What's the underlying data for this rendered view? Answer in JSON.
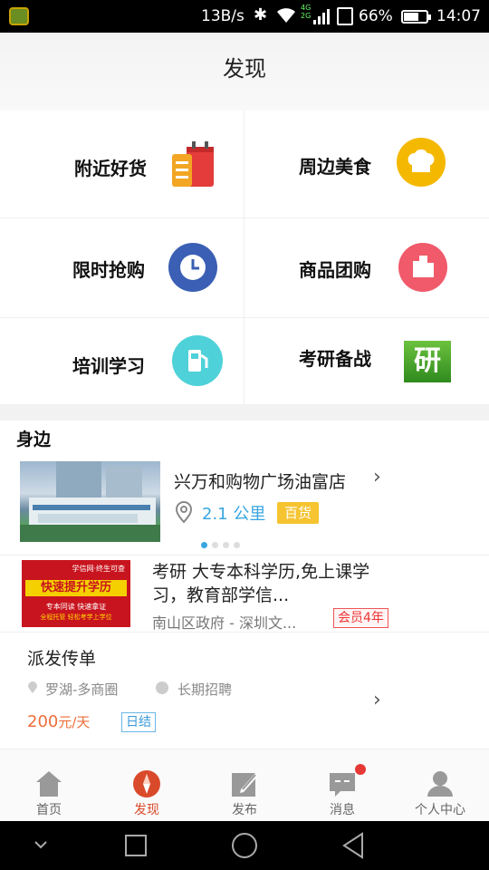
{
  "status_bar": {
    "speed": "13B/s",
    "network": "4G\n2G",
    "battery_percent": "66%",
    "battery_level": 0.66,
    "time": "14:07",
    "icons": [
      "app-notification-icon",
      "bluetooth-icon",
      "wifi-icon",
      "signal-icon",
      "sim-icon",
      "battery-icon"
    ]
  },
  "header": {
    "title": "发现"
  },
  "grid": {
    "items": [
      {
        "label": "附近好货",
        "icon": "shopping-bag-icon"
      },
      {
        "label": "周边美食",
        "icon": "chef-hat-icon",
        "color": "#f5b800"
      },
      {
        "label": "限时抢购",
        "icon": "clock-icon",
        "color": "#3a5fb4"
      },
      {
        "label": "商品团购",
        "icon": "buildings-icon",
        "color": "#f05a6b"
      },
      {
        "label": "培训学习",
        "icon": "gas-pump-icon",
        "color": "#4fd1d9"
      },
      {
        "label": "考研备战",
        "icon": "study-icon",
        "icon_text": "研",
        "color": "#3c9a2a"
      }
    ]
  },
  "nearby": {
    "title": "身边",
    "store": {
      "name": "兴万和购物广场油富店",
      "distance": "2.1 公里",
      "tag": "百货"
    },
    "carousel": {
      "count": 4,
      "active": 0
    },
    "ad": {
      "img_line1": "学信网·终生可查",
      "img_line2": "快速提升学历",
      "img_line3": "专本同读 快速拿证",
      "img_line4": "全程托管 轻松考学上学位",
      "text": "考研 大专本科学历,免上课学习，教育部学信...",
      "meta": "南山区政府 - 深圳文...",
      "badge": "会员4年"
    },
    "job": {
      "title": "派发传单",
      "location": "罗湖-多商圈",
      "duration": "长期招聘",
      "salary": "200",
      "salary_unit": "元/天",
      "settle": "日结"
    }
  },
  "tabbar": {
    "tabs": [
      {
        "label": "首页",
        "icon": "home-icon"
      },
      {
        "label": "发现",
        "icon": "compass-icon",
        "active": true
      },
      {
        "label": "发布",
        "icon": "edit-icon"
      },
      {
        "label": "消息",
        "icon": "message-icon",
        "badge": true
      },
      {
        "label": "个人中心",
        "icon": "user-icon"
      }
    ]
  },
  "colors": {
    "accent": "#d94a2b",
    "link_blue": "#3aa6e0",
    "salary_orange": "#ee6e3a"
  }
}
